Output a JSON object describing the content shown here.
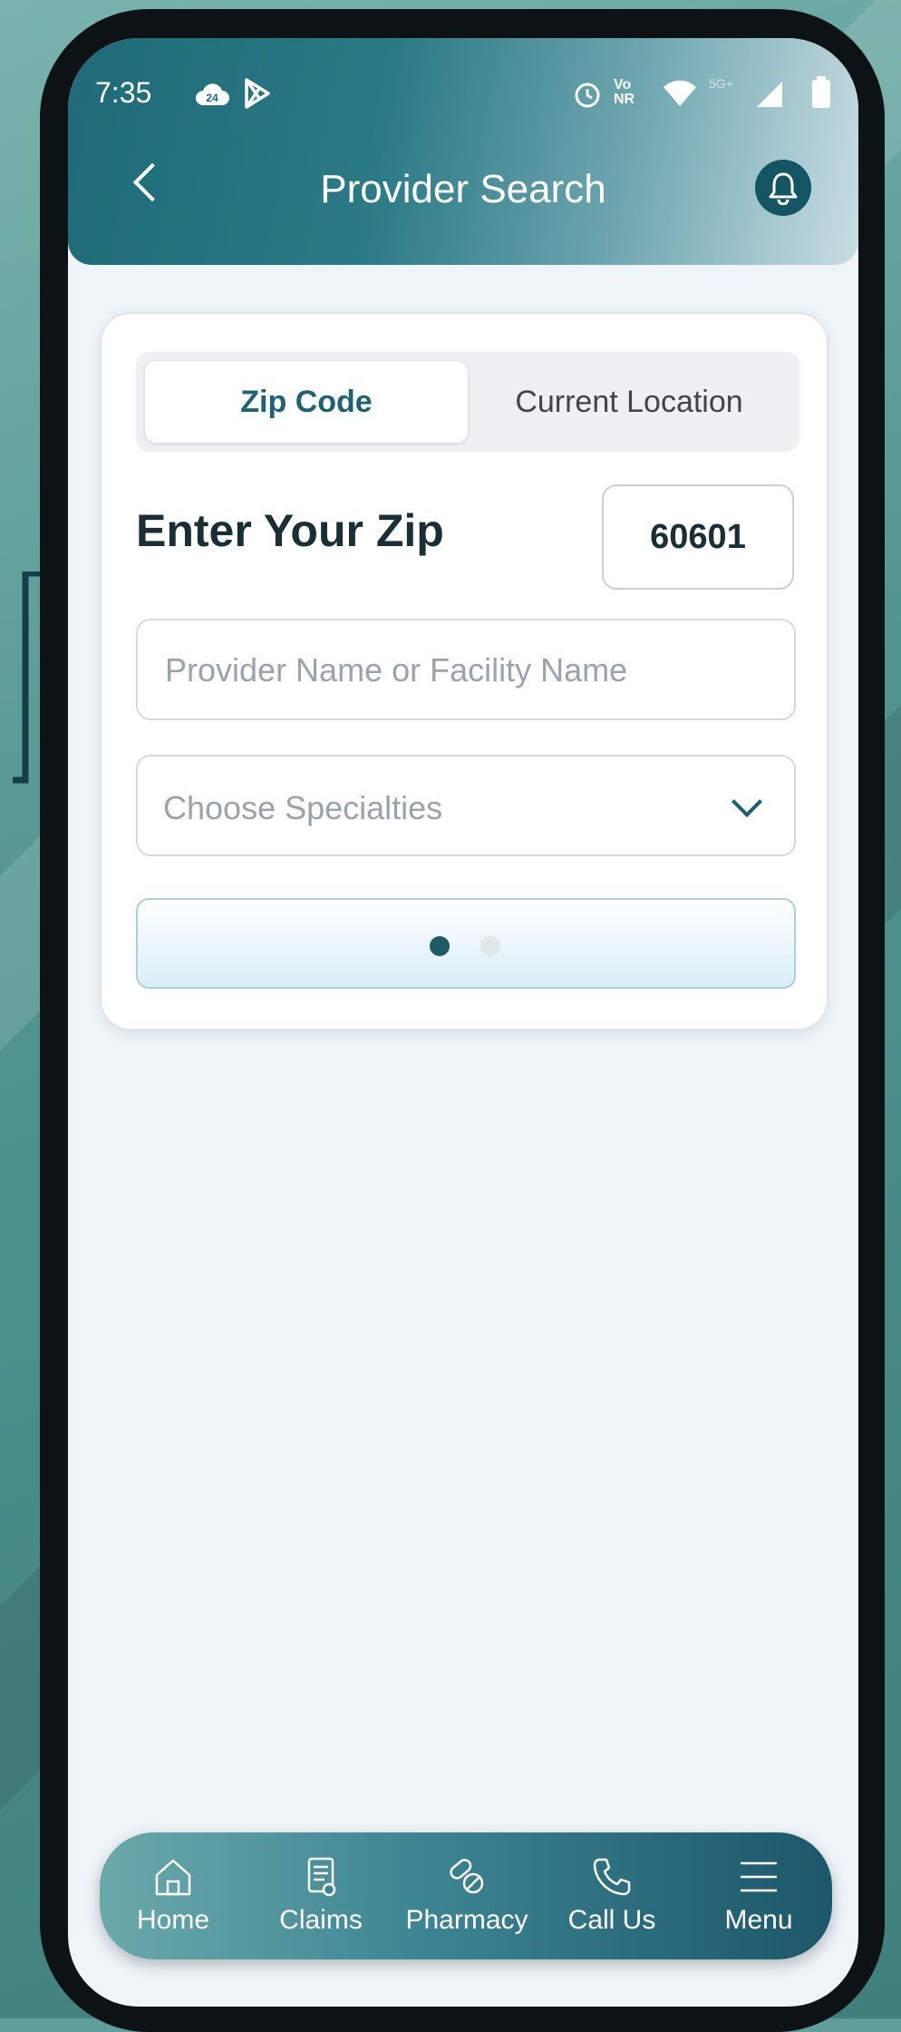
{
  "status_bar": {
    "time": "7:35",
    "badge": "24",
    "network": "Vo NR",
    "signal_label": "5G+"
  },
  "header": {
    "title": "Provider Search"
  },
  "tabs": {
    "zip_code": "Zip Code",
    "current_location": "Current Location",
    "selected": "Zip Code"
  },
  "zip": {
    "label": "Enter Your Zip",
    "value": "60601"
  },
  "provider_search": {
    "placeholder": "Provider Name or Facility Name",
    "value": ""
  },
  "specialties": {
    "placeholder": "Choose Specialties"
  },
  "loading": {
    "active_dot": 1,
    "dot_count": 2
  },
  "bottom_nav": {
    "items": [
      {
        "label": "Home",
        "icon": "home-icon"
      },
      {
        "label": "Claims",
        "icon": "claims-icon"
      },
      {
        "label": "Pharmacy",
        "icon": "pharmacy-icon"
      },
      {
        "label": "Call Us",
        "icon": "phone-icon"
      },
      {
        "label": "Menu",
        "icon": "menu-icon"
      }
    ]
  },
  "colors": {
    "header": "#1e6a78",
    "accent": "#1e6273",
    "nav_start": "#6aa9ab",
    "nav_end": "#1c5769"
  }
}
